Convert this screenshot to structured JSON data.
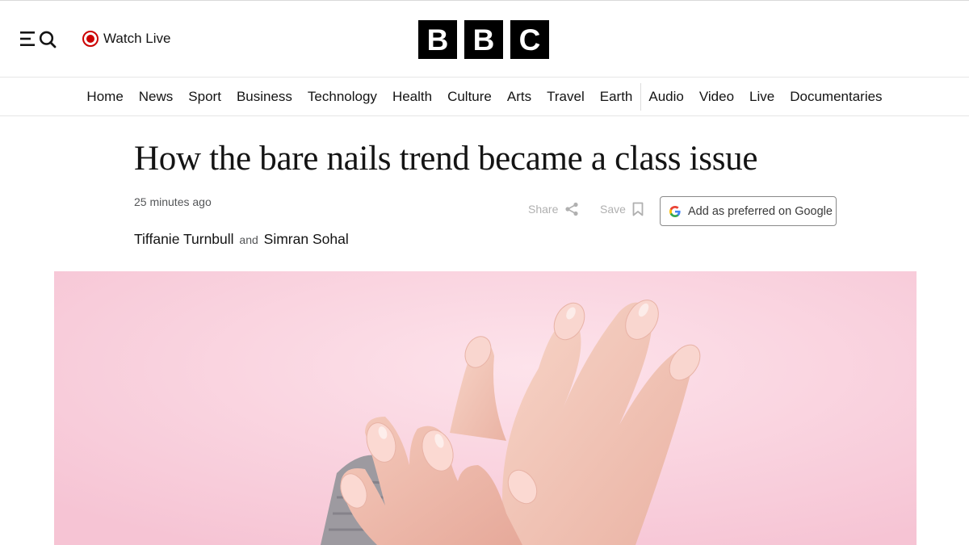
{
  "header": {
    "menu_icon": "menu-search-icon",
    "watch_live_label": "Watch Live",
    "live_icon": "live-record-icon",
    "logo_letters": [
      "B",
      "B",
      "C"
    ]
  },
  "nav": {
    "items": [
      "Home",
      "News",
      "Sport",
      "Business",
      "Technology",
      "Health",
      "Culture",
      "Arts",
      "Travel",
      "Earth",
      "Audio",
      "Video",
      "Live",
      "Documentaries"
    ]
  },
  "article": {
    "headline": "How the bare nails trend became a class issue",
    "timestamp": "25 minutes ago",
    "share_label": "Share",
    "save_label": "Save",
    "google_label": "Add as preferred on Google",
    "authors": [
      "Tiffanie Turnbull",
      "Simran Sohal"
    ],
    "author_joiner": "and"
  },
  "colors": {
    "live_red": "#cc0000",
    "logo_black": "#000000",
    "hero_pink": "#f8cedb"
  }
}
